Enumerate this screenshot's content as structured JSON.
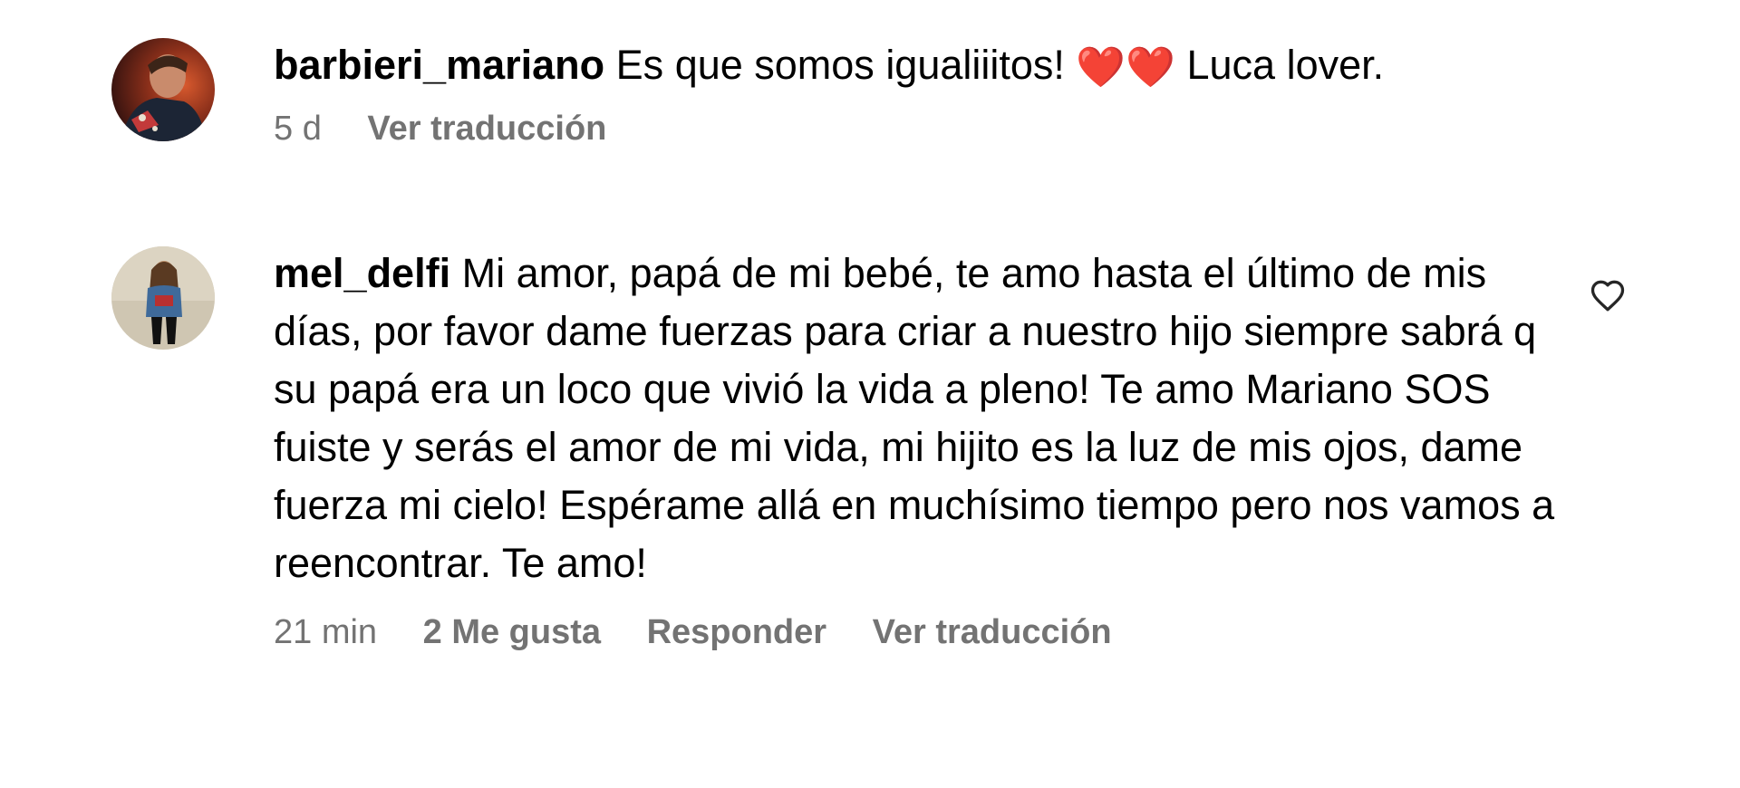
{
  "comments": [
    {
      "username": "barbieri_mariano",
      "text_before": "Es que somos igualiiitos! ",
      "emoji": "❤️❤️",
      "text_after": " Luca lover.",
      "time": "5 d",
      "translate_label": "Ver traducción"
    },
    {
      "username": "mel_delfi",
      "text": "Mi amor, papá de mi bebé, te amo hasta el último de mis días, por favor dame fuerzas para criar a nuestro hijo siempre sabrá q su papá era un loco que vivió la vida a pleno! Te amo Mariano SOS fuiste y serás el amor de mi vida, mi hijito es la luz de mis ojos, dame fuerza mi cielo! Espérame allá en muchísimo tiempo pero nos vamos a reencontrar. Te amo!",
      "time": "21 min",
      "likes_label": "2 Me gusta",
      "reply_label": "Responder",
      "translate_label": "Ver traducción"
    }
  ],
  "colors": {
    "text": "#000000",
    "meta": "#737373"
  },
  "icons": {
    "like": "heart-outline-icon"
  }
}
